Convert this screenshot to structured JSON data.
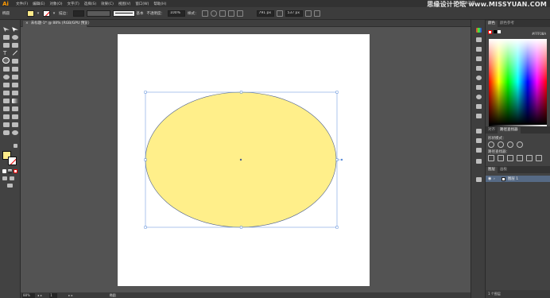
{
  "app": {
    "logo": "Ai",
    "menus": [
      "文件(F)",
      "编辑(E)",
      "对象(O)",
      "文字(T)",
      "选择(S)",
      "效果(C)",
      "视图(V)",
      "窗口(W)",
      "帮助(H)"
    ],
    "workspace": "传统基本功能",
    "watermark": "思缘设计论坛 www.MISSYUAN.COM"
  },
  "controlbar": {
    "selection_label": "椭圆",
    "fill_color": "#ffeb8a",
    "stroke_label": "描边：",
    "stroke_style_label": "基本",
    "opacity_label": "不透明度：",
    "opacity_value": "100%",
    "style_label": "样式：",
    "width_value": "791 px",
    "height_value": "537 px"
  },
  "document": {
    "tab_title": "未标题-1* @ 88% (RGB/GPU 预览)",
    "tab_close": "×"
  },
  "statusbar": {
    "zoom": "88%",
    "page": "1",
    "tool_name": "椭圆"
  },
  "color_panel": {
    "tabs": [
      "颜色",
      "颜色参考"
    ],
    "hex": "FFF08A"
  },
  "pathfinder_panel": {
    "tabs": [
      "对齐",
      "路径查找器"
    ],
    "shape_modes_label": "形状模式：",
    "pathfinders_label": "路径查找器："
  },
  "layers_panel": {
    "tabs": [
      "图层",
      "画板"
    ],
    "layer_name": "图层 1",
    "footer": "1 个图层"
  },
  "ellipse": {
    "fill": "#ffef8a",
    "stroke": "#4b5f8f",
    "bbox_color": "#5b8dd9"
  }
}
